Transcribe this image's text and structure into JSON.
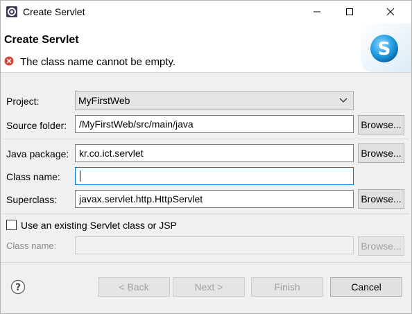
{
  "window": {
    "title": "Create Servlet",
    "controls": [
      "minimize-icon",
      "maximize-icon",
      "close-icon"
    ]
  },
  "banner": {
    "heading": "Create Servlet",
    "error_message": "The class name cannot be empty.",
    "logo_letter": "S",
    "error_color": "#d9443a",
    "logo_color": "#1e9de0"
  },
  "form": {
    "project": {
      "label": "Project:",
      "value": "MyFirstWeb"
    },
    "source_folder": {
      "label": "Source folder:",
      "value": "/MyFirstWeb/src/main/java",
      "browse": "Browse..."
    },
    "java_package": {
      "label": "Java package:",
      "value": "kr.co.ict.servlet",
      "browse": "Browse..."
    },
    "class_name": {
      "label": "Class name:",
      "value": ""
    },
    "superclass": {
      "label": "Superclass:",
      "value": "javax.servlet.http.HttpServlet",
      "browse": "Browse..."
    },
    "use_existing": {
      "label": "Use an existing Servlet class or JSP",
      "checked": false
    },
    "existing_class_name": {
      "label": "Class name:",
      "value": "",
      "browse": "Browse..."
    }
  },
  "footer": {
    "back": "< Back",
    "next": "Next >",
    "finish": "Finish",
    "cancel": "Cancel"
  },
  "colors": {
    "focus_border": "#0078d7",
    "dialog_bg": "#f0f0f0"
  }
}
